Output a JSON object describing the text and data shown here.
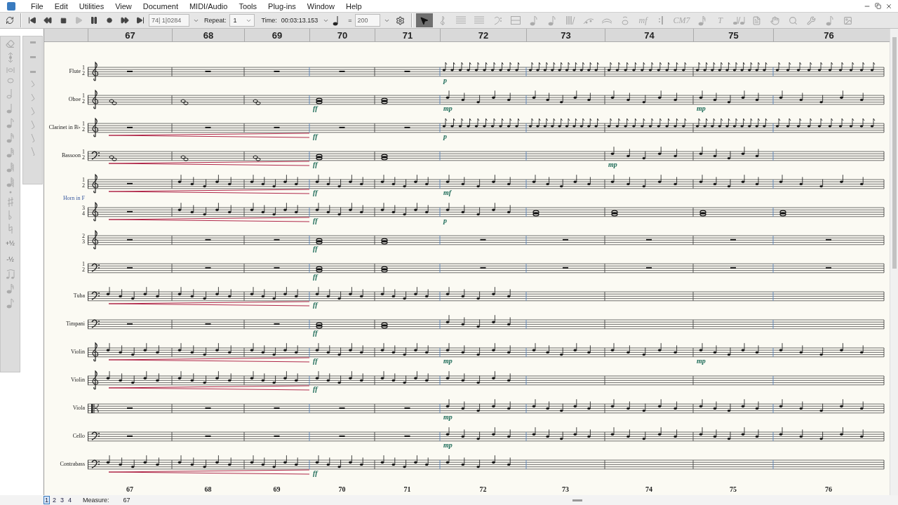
{
  "menu": [
    "File",
    "Edit",
    "Utilities",
    "View",
    "Document",
    "MIDI/Audio",
    "Tools",
    "Plug-ins",
    "Window",
    "Help"
  ],
  "transport": [
    {
      "kind": "start",
      "disabled": false
    },
    {
      "kind": "rewind",
      "disabled": false
    },
    {
      "kind": "stop",
      "disabled": false
    },
    {
      "kind": "play",
      "disabled": true
    },
    {
      "kind": "pause",
      "disabled": false
    },
    {
      "kind": "record",
      "disabled": false
    },
    {
      "kind": "forward",
      "disabled": false
    },
    {
      "kind": "end",
      "disabled": false
    }
  ],
  "position": "74| 1|0284",
  "repeat_label": "Repeat:",
  "repeat_value": "1",
  "time_label": "Time:",
  "time_value": "00:03:13.153",
  "equals": "=",
  "tempo": "200",
  "tools": [
    {
      "kind": "arrow",
      "selected": true
    },
    {
      "kind": "clef",
      "selected": false
    },
    {
      "kind": "staff",
      "selected": false
    },
    {
      "kind": "lines",
      "selected": false
    },
    {
      "kind": "bass",
      "selected": false
    },
    {
      "kind": "measure",
      "selected": false
    },
    {
      "kind": "note",
      "selected": false
    },
    {
      "kind": "note",
      "selected": false
    },
    {
      "kind": "bars",
      "selected": false
    },
    {
      "kind": "tuplet",
      "selected": false
    },
    {
      "kind": "slur",
      "selected": false
    },
    {
      "kind": "ornament",
      "selected": false
    },
    {
      "kind": "text",
      "label": "mf",
      "selected": false
    },
    {
      "kind": "repeat",
      "selected": false
    },
    {
      "kind": "text",
      "label": "CM7",
      "selected": false
    },
    {
      "kind": "lyrics",
      "selected": false
    },
    {
      "kind": "text",
      "label": "T",
      "selected": false
    },
    {
      "kind": "tempo",
      "selected": false
    },
    {
      "kind": "page",
      "selected": false
    },
    {
      "kind": "hand",
      "selected": false
    },
    {
      "kind": "zoom",
      "selected": false
    },
    {
      "kind": "wrench",
      "selected": false
    },
    {
      "kind": "note",
      "selected": false
    },
    {
      "kind": "image",
      "selected": false
    }
  ],
  "palette_labels": [
    "+½",
    "-½"
  ],
  "ruler": [
    "67",
    "68",
    "69",
    "70",
    "71",
    "72",
    "73",
    "74",
    "75",
    "76"
  ],
  "staves": [
    {
      "name": "Flute",
      "numbers": [
        "1",
        "2"
      ],
      "kind": "treble",
      "crescendo": false,
      "measures": [
        {
          "kind": "rest"
        },
        {
          "kind": "rest"
        },
        {
          "kind": "rest"
        },
        {
          "kind": "rest"
        },
        {
          "kind": "rest"
        },
        {
          "kind": "fast",
          "dynamic": "p"
        },
        {
          "kind": "fast"
        },
        {
          "kind": "fast"
        },
        {
          "kind": "fast"
        },
        {
          "kind": "fast"
        }
      ]
    },
    {
      "name": "Oboe",
      "numbers": [
        "1",
        "2"
      ],
      "kind": "treble",
      "crescendo": false,
      "measures": [
        {
          "kind": "chord"
        },
        {
          "kind": "chord"
        },
        {
          "kind": "chord"
        },
        {
          "kind": "whole",
          "dynamic": "ff"
        },
        {
          "kind": "whole"
        },
        {
          "kind": "quarters",
          "dynamic": "mp"
        },
        {
          "kind": "quarters"
        },
        {
          "kind": "quarters"
        },
        {
          "kind": "quarters",
          "dynamic": "mp"
        },
        {
          "kind": "quarters"
        }
      ]
    },
    {
      "name": "Clarinet in B♭",
      "numbers": [
        "1",
        "2"
      ],
      "kind": "treble",
      "crescendo": true,
      "measures": [
        {
          "kind": "rest"
        },
        {
          "kind": "rest"
        },
        {
          "kind": "rest"
        },
        {
          "kind": "rest",
          "dynamic": "ff"
        },
        {
          "kind": "rest"
        },
        {
          "kind": "fast",
          "dynamic": "p"
        },
        {
          "kind": "fast"
        },
        {
          "kind": "fast"
        },
        {
          "kind": "fast"
        },
        {
          "kind": "fast"
        }
      ]
    },
    {
      "name": "Bassoon",
      "numbers": [
        "1",
        "2"
      ],
      "kind": "bass",
      "crescendo": true,
      "measures": [
        {
          "kind": "chord"
        },
        {
          "kind": "chord"
        },
        {
          "kind": "chord"
        },
        {
          "kind": "whole",
          "dynamic": "ff"
        },
        {
          "kind": "whole"
        },
        {
          "kind": "empty"
        },
        {
          "kind": "empty"
        },
        {
          "kind": "quarters",
          "dynamic": "mp"
        },
        {
          "kind": "quarters"
        },
        {
          "kind": "empty"
        }
      ]
    },
    {
      "numbers": [
        "1",
        "2"
      ],
      "group_label": "Horn in F",
      "kind": "treble",
      "crescendo": true,
      "measures": [
        {
          "kind": "rest"
        },
        {
          "kind": "quarters"
        },
        {
          "kind": "quarters"
        },
        {
          "kind": "quarters",
          "dynamic": "ff"
        },
        {
          "kind": "quarters"
        },
        {
          "kind": "quarters",
          "dynamic": "mf"
        },
        {
          "kind": "quarters"
        },
        {
          "kind": "quarters"
        },
        {
          "kind": "quarters"
        },
        {
          "kind": "quarters"
        }
      ]
    },
    {
      "numbers": [
        "3",
        "4"
      ],
      "kind": "treble",
      "crescendo": true,
      "measures": [
        {
          "kind": "rest"
        },
        {
          "kind": "quarters"
        },
        {
          "kind": "quarters"
        },
        {
          "kind": "quarters",
          "dynamic": "ff"
        },
        {
          "kind": "quarters"
        },
        {
          "kind": "quarters",
          "dynamic": "p"
        },
        {
          "kind": "whole"
        },
        {
          "kind": "whole"
        },
        {
          "kind": "whole"
        },
        {
          "kind": "whole"
        }
      ]
    },
    {
      "numbers": [
        "2",
        "3"
      ],
      "kind": "treble",
      "crescendo": false,
      "measures": [
        {
          "kind": "rest"
        },
        {
          "kind": "rest"
        },
        {
          "kind": "rest"
        },
        {
          "kind": "whole",
          "dynamic": "ff"
        },
        {
          "kind": "whole"
        },
        {
          "kind": "rest"
        },
        {
          "kind": "rest"
        },
        {
          "kind": "rest"
        },
        {
          "kind": "rest"
        },
        {
          "kind": "rest"
        }
      ]
    },
    {
      "numbers": [
        "1",
        "2"
      ],
      "kind": "bass",
      "crescendo": false,
      "measures": [
        {
          "kind": "rest"
        },
        {
          "kind": "rest"
        },
        {
          "kind": "rest"
        },
        {
          "kind": "whole",
          "dynamic": "ff"
        },
        {
          "kind": "whole"
        },
        {
          "kind": "rest"
        },
        {
          "kind": "rest"
        },
        {
          "kind": "rest"
        },
        {
          "kind": "rest"
        },
        {
          "kind": "rest"
        }
      ]
    },
    {
      "name": "Tuba",
      "kind": "bass",
      "crescendo": true,
      "measures": [
        {
          "kind": "quarters"
        },
        {
          "kind": "quarters"
        },
        {
          "kind": "quarters"
        },
        {
          "kind": "quarters",
          "dynamic": "ff"
        },
        {
          "kind": "quarters"
        },
        {
          "kind": "quarters"
        },
        {
          "kind": "empty"
        },
        {
          "kind": "empty"
        },
        {
          "kind": "empty"
        },
        {
          "kind": "empty"
        }
      ]
    },
    {
      "name": "Timpani",
      "kind": "bass",
      "crescendo": false,
      "measures": [
        {
          "kind": "rest"
        },
        {
          "kind": "rest"
        },
        {
          "kind": "rest"
        },
        {
          "kind": "whole",
          "dynamic": "ff"
        },
        {
          "kind": "whole"
        },
        {
          "kind": "quarters"
        },
        {
          "kind": "empty"
        },
        {
          "kind": "empty"
        },
        {
          "kind": "empty"
        },
        {
          "kind": "empty"
        }
      ]
    },
    {
      "name": "Violin",
      "kind": "treble",
      "crescendo": true,
      "measures": [
        {
          "kind": "quarters"
        },
        {
          "kind": "quarters"
        },
        {
          "kind": "quarters"
        },
        {
          "kind": "quarters",
          "dynamic": "ff"
        },
        {
          "kind": "quarters"
        },
        {
          "kind": "quarters",
          "dynamic": "mp"
        },
        {
          "kind": "quarters"
        },
        {
          "kind": "quarters"
        },
        {
          "kind": "quarters",
          "dynamic": "mp"
        },
        {
          "kind": "quarters"
        }
      ]
    },
    {
      "name": "Violin",
      "kind": "treble",
      "crescendo": true,
      "measures": [
        {
          "kind": "quarters"
        },
        {
          "kind": "quarters"
        },
        {
          "kind": "quarters"
        },
        {
          "kind": "quarters",
          "dynamic": "ff"
        },
        {
          "kind": "quarters"
        },
        {
          "kind": "quarters"
        },
        {
          "kind": "empty"
        },
        {
          "kind": "empty"
        },
        {
          "kind": "empty"
        },
        {
          "kind": "empty"
        }
      ]
    },
    {
      "name": "Viola",
      "kind": "alto",
      "crescendo": false,
      "measures": [
        {
          "kind": "rest"
        },
        {
          "kind": "rest"
        },
        {
          "kind": "rest"
        },
        {
          "kind": "rest"
        },
        {
          "kind": "rest"
        },
        {
          "kind": "quarters",
          "dynamic": "mp"
        },
        {
          "kind": "quarters"
        },
        {
          "kind": "quarters"
        },
        {
          "kind": "quarters"
        },
        {
          "kind": "quarters"
        }
      ]
    },
    {
      "name": "Cello",
      "kind": "bass",
      "crescendo": false,
      "measures": [
        {
          "kind": "rest"
        },
        {
          "kind": "rest"
        },
        {
          "kind": "rest"
        },
        {
          "kind": "rest"
        },
        {
          "kind": "rest"
        },
        {
          "kind": "quarters",
          "dynamic": "mp"
        },
        {
          "kind": "quarters"
        },
        {
          "kind": "quarters"
        },
        {
          "kind": "quarters"
        },
        {
          "kind": "quarters"
        }
      ]
    },
    {
      "name": "Contrabass",
      "kind": "bass",
      "crescendo": true,
      "measures": [
        {
          "kind": "quarters"
        },
        {
          "kind": "quarters"
        },
        {
          "kind": "quarters"
        },
        {
          "kind": "quarters",
          "dynamic": "ff"
        },
        {
          "kind": "quarters"
        },
        {
          "kind": "quarters"
        },
        {
          "kind": "empty"
        },
        {
          "kind": "empty"
        },
        {
          "kind": "empty"
        },
        {
          "kind": "empty"
        }
      ]
    }
  ],
  "footer_numbers": [
    "67",
    "68",
    "69",
    "70",
    "71",
    "72",
    "73",
    "74",
    "75",
    "76"
  ],
  "pages": [
    {
      "label": "1",
      "selected": true
    },
    {
      "label": "2",
      "selected": false
    },
    {
      "label": "3",
      "selected": false
    },
    {
      "label": "4",
      "selected": false
    }
  ],
  "measure_label": "Measure:",
  "measure_value": "67"
}
